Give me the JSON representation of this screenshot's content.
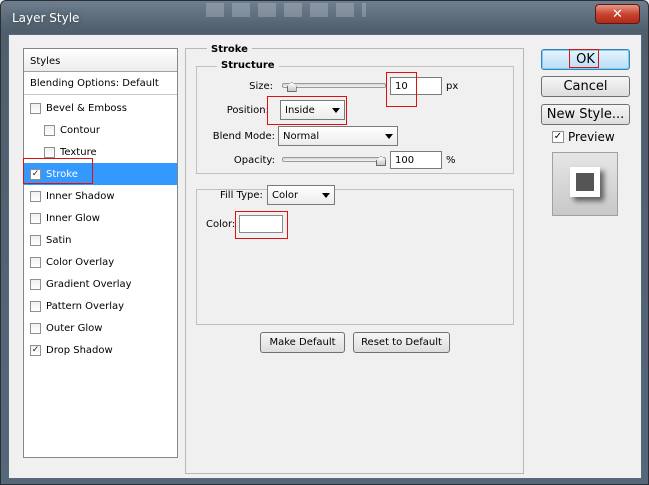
{
  "window": {
    "title": "Layer Style",
    "close_glyph": "✕"
  },
  "styles_panel": {
    "header": "Styles",
    "blending_options": "Blending Options: Default",
    "items": [
      {
        "label": "Bevel & Emboss",
        "checked": false,
        "indent": false
      },
      {
        "label": "Contour",
        "checked": false,
        "indent": true
      },
      {
        "label": "Texture",
        "checked": false,
        "indent": true
      },
      {
        "label": "Stroke",
        "checked": true,
        "indent": false,
        "selected": true
      },
      {
        "label": "Inner Shadow",
        "checked": false,
        "indent": false
      },
      {
        "label": "Inner Glow",
        "checked": false,
        "indent": false
      },
      {
        "label": "Satin",
        "checked": false,
        "indent": false
      },
      {
        "label": "Color Overlay",
        "checked": false,
        "indent": false
      },
      {
        "label": "Gradient Overlay",
        "checked": false,
        "indent": false
      },
      {
        "label": "Pattern Overlay",
        "checked": false,
        "indent": false
      },
      {
        "label": "Outer Glow",
        "checked": false,
        "indent": false
      },
      {
        "label": "Drop Shadow",
        "checked": true,
        "indent": false
      }
    ]
  },
  "stroke": {
    "group_title": "Stroke",
    "structure_title": "Structure",
    "size_label": "Size:",
    "size_value": "10",
    "size_unit": "px",
    "size_slider_fraction": 0.05,
    "position_label": "Position:",
    "position_value": "Inside",
    "blend_mode_label": "Blend Mode:",
    "blend_mode_value": "Normal",
    "opacity_label": "Opacity:",
    "opacity_value": "100",
    "opacity_unit": "%",
    "opacity_slider_fraction": 1.0,
    "fill_type_label": "Fill Type:",
    "fill_type_value": "Color",
    "color_label": "Color:",
    "color_value": "#ffffff",
    "make_default": "Make Default",
    "reset_default": "Reset to Default"
  },
  "right_buttons": {
    "ok": "OK",
    "cancel": "Cancel",
    "new_style": "New Style...",
    "preview_label": "Preview",
    "preview_checked": true
  },
  "checkmark": "✓"
}
